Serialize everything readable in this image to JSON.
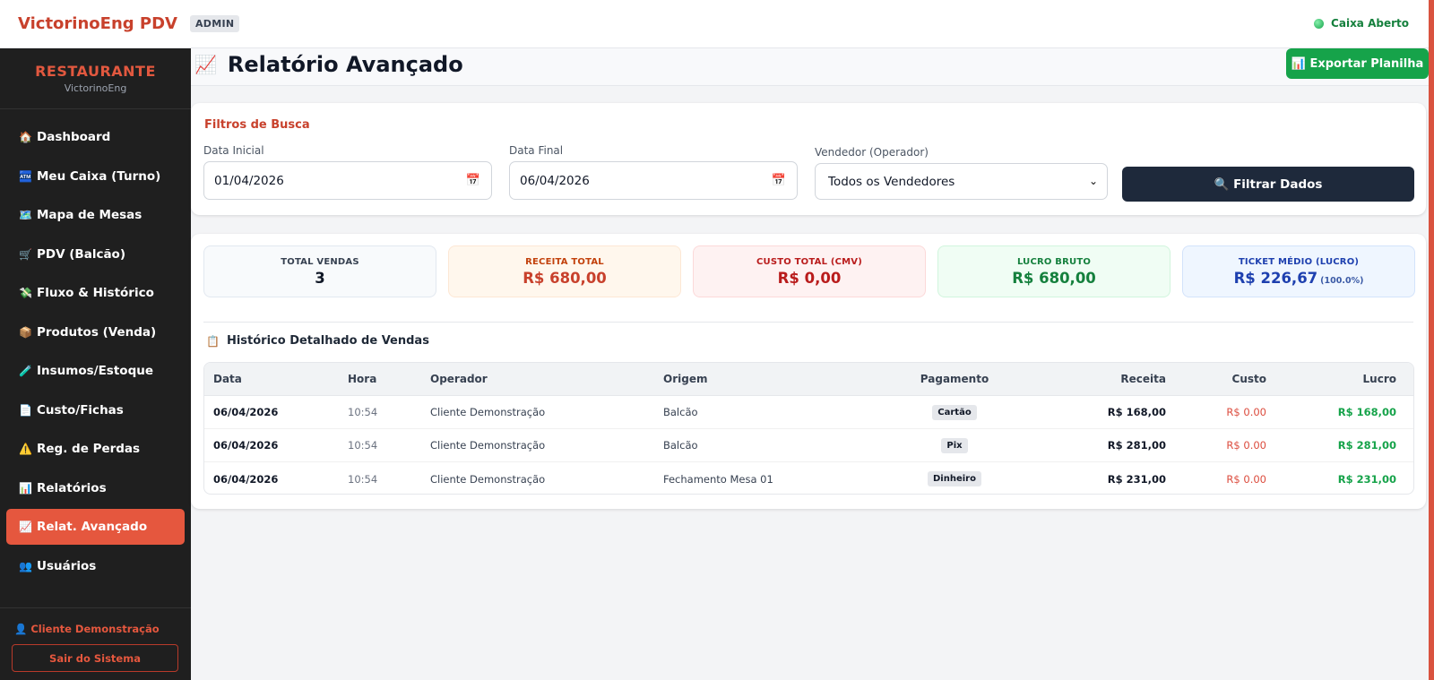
{
  "app": {
    "brand": "VictorinoEng PDV",
    "role": "ADMIN",
    "status": "Caixa Aberto"
  },
  "sidebar": {
    "title": "RESTAURANTE",
    "subtitle": "VictorinoEng",
    "items": [
      {
        "icon": "🏠",
        "label": "Dashboard"
      },
      {
        "icon": "🏧",
        "label": "Meu Caixa (Turno)"
      },
      {
        "icon": "🗺️",
        "label": "Mapa de Mesas"
      },
      {
        "icon": "🛒",
        "label": "PDV (Balcão)"
      },
      {
        "icon": "💸",
        "label": "Fluxo & Histórico"
      },
      {
        "icon": "📦",
        "label": "Produtos (Venda)"
      },
      {
        "icon": "🧪",
        "label": "Insumos/Estoque"
      },
      {
        "icon": "📄",
        "label": "Custo/Fichas"
      },
      {
        "icon": "⚠️",
        "label": "Reg. de Perdas"
      },
      {
        "icon": "📊",
        "label": "Relatórios"
      },
      {
        "icon": "📈",
        "label": "Relat. Avançado"
      },
      {
        "icon": "👥",
        "label": "Usuários"
      }
    ],
    "user": "👤 Cliente Demonstração",
    "logout": "Sair do Sistema"
  },
  "page": {
    "icon": "📈",
    "title": "Relatório Avançado",
    "export_label": "📊 Exportar Planilha"
  },
  "filters": {
    "title": "Filtros de Busca",
    "start_label": "Data Inicial",
    "start_value": "01/04/2026",
    "end_label": "Data Final",
    "end_value": "06/04/2026",
    "seller_label": "Vendedor (Operador)",
    "seller_value": "Todos os Vendedores",
    "button": "🔍 Filtrar Dados"
  },
  "kpis": {
    "total": {
      "label": "TOTAL VENDAS",
      "value": "3"
    },
    "receita": {
      "label": "RECEITA TOTAL",
      "value": "R$ 680,00"
    },
    "custo": {
      "label": "CUSTO TOTAL (CMV)",
      "value": "R$ 0,00"
    },
    "lucro": {
      "label": "LUCRO BRUTO",
      "value": "R$ 680,00"
    },
    "ticket": {
      "label": "TICKET MÉDIO (LUCRO)",
      "value": "R$ 226,67",
      "pct": "(100.0%)"
    }
  },
  "history": {
    "icon": "📋",
    "title": "Histórico Detalhado de Vendas",
    "columns": [
      "Data",
      "Hora",
      "Operador",
      "Origem",
      "Pagamento",
      "Receita",
      "Custo",
      "Lucro"
    ],
    "rows": [
      {
        "data": "06/04/2026",
        "hora": "10:54",
        "operador": "Cliente Demonstração",
        "origem": "Balcão",
        "pagamento": "Cartão",
        "receita": "R$ 168,00",
        "custo": "R$ 0.00",
        "lucro": "R$ 168,00"
      },
      {
        "data": "06/04/2026",
        "hora": "10:54",
        "operador": "Cliente Demonstração",
        "origem": "Balcão",
        "pagamento": "Pix",
        "receita": "R$ 281,00",
        "custo": "R$ 0.00",
        "lucro": "R$ 281,00"
      },
      {
        "data": "06/04/2026",
        "hora": "10:54",
        "operador": "Cliente Demonstração",
        "origem": "Fechamento Mesa 01",
        "pagamento": "Dinheiro",
        "receita": "R$ 231,00",
        "custo": "R$ 0.00",
        "lucro": "R$ 231,00"
      }
    ]
  }
}
